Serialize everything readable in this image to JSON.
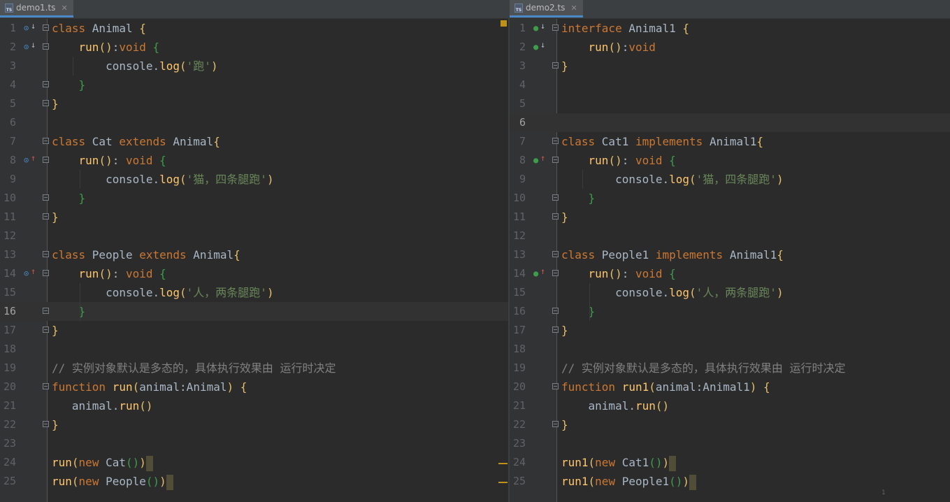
{
  "editors": [
    {
      "tab": {
        "filename": "demo1.ts",
        "icon": "ts-file-icon",
        "close": "✕"
      },
      "current_line": 16,
      "lines": [
        {
          "n": "1",
          "gutter": "override-down",
          "fold": true,
          "code": [
            [
              "k",
              "class "
            ],
            [
              "pl",
              "Animal "
            ],
            [
              "b1",
              "{"
            ]
          ]
        },
        {
          "n": "2",
          "gutter": "override-down",
          "fold": true,
          "code": [
            [
              "pl",
              "    "
            ],
            [
              "f",
              "run"
            ],
            [
              "b1",
              "()"
            ],
            [
              "pl",
              ":"
            ],
            [
              "k",
              "void "
            ],
            [
              "b2",
              "{"
            ]
          ]
        },
        {
          "n": "3",
          "gutter": "",
          "fold": false,
          "code": [
            [
              "pl",
              "        console."
            ],
            [
              "f",
              "log"
            ],
            [
              "b1",
              "("
            ],
            [
              "s",
              "'跑'"
            ],
            [
              "b1",
              ")"
            ]
          ]
        },
        {
          "n": "4",
          "gutter": "",
          "fold": true,
          "code": [
            [
              "pl",
              "    "
            ],
            [
              "b2",
              "}"
            ]
          ]
        },
        {
          "n": "5",
          "gutter": "",
          "fold": true,
          "code": [
            [
              "b1",
              "}"
            ]
          ]
        },
        {
          "n": "6",
          "gutter": "",
          "fold": false,
          "code": []
        },
        {
          "n": "7",
          "gutter": "",
          "fold": true,
          "code": [
            [
              "k",
              "class "
            ],
            [
              "pl",
              "Cat "
            ],
            [
              "k",
              "extends "
            ],
            [
              "pl",
              "Animal"
            ],
            [
              "b1",
              "{"
            ]
          ]
        },
        {
          "n": "8",
          "gutter": "override-up",
          "fold": true,
          "code": [
            [
              "pl",
              "    "
            ],
            [
              "f",
              "run"
            ],
            [
              "b1",
              "()"
            ],
            [
              "pl",
              ": "
            ],
            [
              "k",
              "void "
            ],
            [
              "b2",
              "{"
            ]
          ]
        },
        {
          "n": "9",
          "gutter": "",
          "fold": false,
          "code": [
            [
              "pl",
              "        console."
            ],
            [
              "f",
              "log"
            ],
            [
              "b1",
              "("
            ],
            [
              "s",
              "'猫，四条腿跑'"
            ],
            [
              "b1",
              ")"
            ]
          ]
        },
        {
          "n": "10",
          "gutter": "",
          "fold": true,
          "code": [
            [
              "pl",
              "    "
            ],
            [
              "b2",
              "}"
            ]
          ]
        },
        {
          "n": "11",
          "gutter": "",
          "fold": true,
          "code": [
            [
              "b1",
              "}"
            ]
          ]
        },
        {
          "n": "12",
          "gutter": "",
          "fold": false,
          "code": []
        },
        {
          "n": "13",
          "gutter": "",
          "fold": true,
          "code": [
            [
              "k",
              "class "
            ],
            [
              "pl",
              "People "
            ],
            [
              "k",
              "extends "
            ],
            [
              "pl",
              "Animal"
            ],
            [
              "b1",
              "{"
            ]
          ]
        },
        {
          "n": "14",
          "gutter": "override-up",
          "fold": true,
          "code": [
            [
              "pl",
              "    "
            ],
            [
              "f",
              "run"
            ],
            [
              "b1",
              "()"
            ],
            [
              "pl",
              ": "
            ],
            [
              "k",
              "void "
            ],
            [
              "b2",
              "{"
            ]
          ]
        },
        {
          "n": "15",
          "gutter": "",
          "fold": false,
          "code": [
            [
              "pl",
              "        console."
            ],
            [
              "f",
              "log"
            ],
            [
              "b1",
              "("
            ],
            [
              "s",
              "'人，两条腿跑'"
            ],
            [
              "b1",
              ")"
            ]
          ]
        },
        {
          "n": "16",
          "gutter": "",
          "fold": true,
          "code": [
            [
              "pl",
              "    "
            ],
            [
              "b2",
              "}"
            ]
          ]
        },
        {
          "n": "17",
          "gutter": "",
          "fold": true,
          "code": [
            [
              "b1",
              "}"
            ]
          ]
        },
        {
          "n": "18",
          "gutter": "",
          "fold": false,
          "code": []
        },
        {
          "n": "19",
          "gutter": "",
          "fold": false,
          "code": [
            [
              "c",
              "// 实例对象默认是多态的，具体执行效果由 运行时决定"
            ]
          ]
        },
        {
          "n": "20",
          "gutter": "",
          "fold": true,
          "code": [
            [
              "k",
              "function "
            ],
            [
              "f",
              "run"
            ],
            [
              "b1",
              "("
            ],
            [
              "pl",
              "animal:Animal"
            ],
            [
              "b1",
              ") {"
            ]
          ]
        },
        {
          "n": "21",
          "gutter": "",
          "fold": false,
          "code": [
            [
              "pl",
              "   animal."
            ],
            [
              "f",
              "run"
            ],
            [
              "b1",
              "()"
            ]
          ]
        },
        {
          "n": "22",
          "gutter": "",
          "fold": true,
          "code": [
            [
              "b1",
              "}"
            ]
          ]
        },
        {
          "n": "23",
          "gutter": "",
          "fold": false,
          "code": []
        },
        {
          "n": "24",
          "gutter": "",
          "fold": false,
          "code": [
            [
              "f",
              "run"
            ],
            [
              "b1",
              "("
            ],
            [
              "k",
              "new "
            ],
            [
              "pl",
              "Cat"
            ],
            [
              "b2",
              "()"
            ],
            [
              "b1",
              ")"
            ]
          ],
          "caret": true
        },
        {
          "n": "25",
          "gutter": "",
          "fold": false,
          "code": [
            [
              "f",
              "run"
            ],
            [
              "b1",
              "("
            ],
            [
              "k",
              "new "
            ],
            [
              "pl",
              "People"
            ],
            [
              "b2",
              "()"
            ],
            [
              "b1",
              ")"
            ]
          ],
          "caret": true
        }
      ]
    },
    {
      "tab": {
        "filename": "demo2.ts",
        "icon": "ts-file-icon",
        "close": "✕"
      },
      "current_line": 6,
      "page_indicator": "1",
      "lines": [
        {
          "n": "1",
          "gutter": "impl-down",
          "fold": true,
          "code": [
            [
              "k",
              "interface "
            ],
            [
              "pl",
              "Animal1 "
            ],
            [
              "b1",
              "{"
            ]
          ]
        },
        {
          "n": "2",
          "gutter": "impl-down",
          "fold": false,
          "code": [
            [
              "pl",
              "    "
            ],
            [
              "f",
              "run"
            ],
            [
              "b1",
              "()"
            ],
            [
              "pl",
              ":"
            ],
            [
              "k",
              "void"
            ]
          ]
        },
        {
          "n": "3",
          "gutter": "",
          "fold": true,
          "code": [
            [
              "b1",
              "}"
            ]
          ]
        },
        {
          "n": "4",
          "gutter": "",
          "fold": false,
          "code": []
        },
        {
          "n": "5",
          "gutter": "",
          "fold": false,
          "code": []
        },
        {
          "n": "6",
          "gutter": "",
          "fold": false,
          "code": []
        },
        {
          "n": "7",
          "gutter": "",
          "fold": true,
          "code": [
            [
              "k",
              "class "
            ],
            [
              "pl",
              "Cat1 "
            ],
            [
              "k",
              "implements "
            ],
            [
              "pl",
              "Animal1"
            ],
            [
              "b1",
              "{"
            ]
          ]
        },
        {
          "n": "8",
          "gutter": "impl-up",
          "fold": true,
          "code": [
            [
              "pl",
              "    "
            ],
            [
              "f",
              "run"
            ],
            [
              "b1",
              "()"
            ],
            [
              "pl",
              ": "
            ],
            [
              "k",
              "void "
            ],
            [
              "b2",
              "{"
            ]
          ]
        },
        {
          "n": "9",
          "gutter": "",
          "fold": false,
          "code": [
            [
              "pl",
              "        console."
            ],
            [
              "f",
              "log"
            ],
            [
              "b1",
              "("
            ],
            [
              "s",
              "'猫，四条腿跑'"
            ],
            [
              "b1",
              ")"
            ]
          ]
        },
        {
          "n": "10",
          "gutter": "",
          "fold": true,
          "code": [
            [
              "pl",
              "    "
            ],
            [
              "b2",
              "}"
            ]
          ]
        },
        {
          "n": "11",
          "gutter": "",
          "fold": true,
          "code": [
            [
              "b1",
              "}"
            ]
          ]
        },
        {
          "n": "12",
          "gutter": "",
          "fold": false,
          "code": []
        },
        {
          "n": "13",
          "gutter": "",
          "fold": true,
          "code": [
            [
              "k",
              "class "
            ],
            [
              "pl",
              "People1 "
            ],
            [
              "k",
              "implements "
            ],
            [
              "pl",
              "Animal1"
            ],
            [
              "b1",
              "{"
            ]
          ]
        },
        {
          "n": "14",
          "gutter": "impl-up",
          "fold": true,
          "code": [
            [
              "pl",
              "    "
            ],
            [
              "f",
              "run"
            ],
            [
              "b1",
              "()"
            ],
            [
              "pl",
              ": "
            ],
            [
              "k",
              "void "
            ],
            [
              "b2",
              "{"
            ]
          ]
        },
        {
          "n": "15",
          "gutter": "",
          "fold": false,
          "code": [
            [
              "pl",
              "        console."
            ],
            [
              "f",
              "log"
            ],
            [
              "b1",
              "("
            ],
            [
              "s",
              "'人，两条腿跑'"
            ],
            [
              "b1",
              ")"
            ]
          ]
        },
        {
          "n": "16",
          "gutter": "",
          "fold": true,
          "code": [
            [
              "pl",
              "    "
            ],
            [
              "b2",
              "}"
            ]
          ]
        },
        {
          "n": "17",
          "gutter": "",
          "fold": true,
          "code": [
            [
              "b1",
              "}"
            ]
          ]
        },
        {
          "n": "18",
          "gutter": "",
          "fold": false,
          "code": []
        },
        {
          "n": "19",
          "gutter": "",
          "fold": false,
          "code": [
            [
              "c",
              "// 实例对象默认是多态的，具体执行效果由 运行时决定"
            ]
          ]
        },
        {
          "n": "20",
          "gutter": "",
          "fold": true,
          "code": [
            [
              "k",
              "function "
            ],
            [
              "f",
              "run1"
            ],
            [
              "b1",
              "("
            ],
            [
              "pl",
              "animal:Animal1"
            ],
            [
              "b1",
              ") {"
            ]
          ]
        },
        {
          "n": "21",
          "gutter": "",
          "fold": false,
          "code": [
            [
              "pl",
              "    animal."
            ],
            [
              "f",
              "run"
            ],
            [
              "b1",
              "()"
            ]
          ]
        },
        {
          "n": "22",
          "gutter": "",
          "fold": true,
          "code": [
            [
              "b1",
              "}"
            ]
          ]
        },
        {
          "n": "23",
          "gutter": "",
          "fold": false,
          "code": []
        },
        {
          "n": "24",
          "gutter": "",
          "fold": false,
          "code": [
            [
              "f",
              "run1"
            ],
            [
              "b1",
              "("
            ],
            [
              "k",
              "new "
            ],
            [
              "pl",
              "Cat1"
            ],
            [
              "b2",
              "()"
            ],
            [
              "b1",
              ")"
            ]
          ],
          "caret": true
        },
        {
          "n": "25",
          "gutter": "",
          "fold": false,
          "code": [
            [
              "f",
              "run1"
            ],
            [
              "b1",
              "("
            ],
            [
              "k",
              "new "
            ],
            [
              "pl",
              "People1"
            ],
            [
              "b2",
              "()"
            ],
            [
              "b1",
              ")"
            ]
          ],
          "caret": true
        }
      ]
    }
  ]
}
